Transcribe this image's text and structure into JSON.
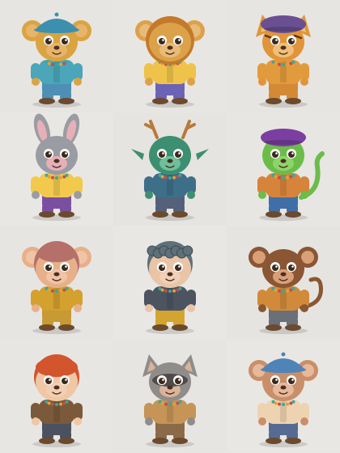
{
  "gallery": {
    "rows": 4,
    "columns": 3,
    "background_color": "#e6e4e0",
    "tiles": [
      {
        "subject": "bear-cub-blue-cap-overalls-icon",
        "bg": "#e7e5e1",
        "fur": "#d9a441",
        "fur_dark": "#b97e25",
        "ear_inner": "#e8b46a",
        "top": "#4aa6b8",
        "pants": "#4d8fb5",
        "hat": "#3d8fb0",
        "ear_shape": "round",
        "has_hat": true
      },
      {
        "subject": "lion-cub-purple-vest-icon",
        "bg": "#e8e6e2",
        "fur": "#dca24a",
        "fur_dark": "#a86a22",
        "ear_inner": "#e9bb7a",
        "top": "#efc34a",
        "pants": "#6b63b5",
        "hat": "",
        "ear_shape": "round",
        "has_hat": false,
        "mane": "#c37a2a"
      },
      {
        "subject": "tiger-cub-purple-beret-icon",
        "bg": "#e7e5e1",
        "fur": "#e0953a",
        "fur_dark": "#5a3418",
        "ear_inner": "#f0c07a",
        "top": "#e29b3c",
        "pants": "#d48a34",
        "hat": "#6a4f93",
        "ear_shape": "pointy",
        "has_hat": true
      },
      {
        "subject": "bunny-yellow-sweater-icon",
        "bg": "#e9e7e3",
        "fur": "#9a9ca3",
        "fur_dark": "#6e7077",
        "ear_inner": "#e6b0b8",
        "top": "#f2c94c",
        "pants": "#7b4fa0",
        "hat": "",
        "ear_shape": "long",
        "has_hat": false
      },
      {
        "subject": "green-dragon-antlers-icon",
        "bg": "#e6e4e0",
        "fur": "#3d8f72",
        "fur_dark": "#2a6a55",
        "ear_inner": "#6fbf9a",
        "top": "#3e6f88",
        "pants": "#55607a",
        "hat": "",
        "ear_shape": "antlers",
        "has_hat": false
      },
      {
        "subject": "green-lizard-purple-hat-icon",
        "bg": "#e8e6e2",
        "fur": "#6cbc4a",
        "fur_dark": "#3f8a2e",
        "ear_inner": "#8fd46b",
        "top": "#d6843c",
        "pants": "#3f6fa6",
        "hat": "#7a3fa0",
        "ear_shape": "none",
        "has_hat": true
      },
      {
        "subject": "monkey-girl-pink-hair-icon",
        "bg": "#e7e5e1",
        "fur": "#e7b08a",
        "fur_dark": "#a5615a",
        "ear_inner": "#f0c4a5",
        "top": "#d4a02e",
        "pants": "#c79a34",
        "hat": "",
        "ear_shape": "round",
        "has_hat": false,
        "hair": "#b5706a"
      },
      {
        "subject": "curly-hair-creature-yellow-pants-icon",
        "bg": "#e9e7e3",
        "fur": "#e9c4a6",
        "fur_dark": "#5c6b72",
        "ear_inner": "#f0d0b6",
        "top": "#4c5460",
        "pants": "#d4a430",
        "hat": "",
        "ear_shape": "none",
        "has_hat": false,
        "hair": "#5e707a"
      },
      {
        "subject": "monkey-orange-shirt-icon",
        "bg": "#e6e4e0",
        "fur": "#8a5634",
        "fur_dark": "#5c3520",
        "ear_inner": "#d9a077",
        "top": "#d08a3a",
        "pants": "#6a6f78",
        "hat": "",
        "ear_shape": "round",
        "has_hat": false
      },
      {
        "subject": "redhead-gnome-beaded-necklace-icon",
        "bg": "#e8e6e2",
        "fur": "#f0c6a4",
        "fur_dark": "#c8502e",
        "ear_inner": "#f3cfb2",
        "top": "#7a5a3a",
        "pants": "#4a5260",
        "hat": "",
        "ear_shape": "none",
        "has_hat": false,
        "hair": "#d2552e"
      },
      {
        "subject": "raccoon-tie-vest-icon",
        "bg": "#e7e5e1",
        "fur": "#8f8c8a",
        "fur_dark": "#4f4b4a",
        "ear_inner": "#d9b39a",
        "top": "#c59456",
        "pants": "#8a6a48",
        "hat": "",
        "ear_shape": "pointy",
        "has_hat": false
      },
      {
        "subject": "monkey-blue-cap-jeans-icon",
        "bg": "#e9e7e3",
        "fur": "#c98f6a",
        "fur_dark": "#8a5a3e",
        "ear_inner": "#e7b89a",
        "top": "#eed3b0",
        "pants": "#556b92",
        "hat": "#4f84b8",
        "ear_shape": "round",
        "has_hat": true
      }
    ]
  }
}
